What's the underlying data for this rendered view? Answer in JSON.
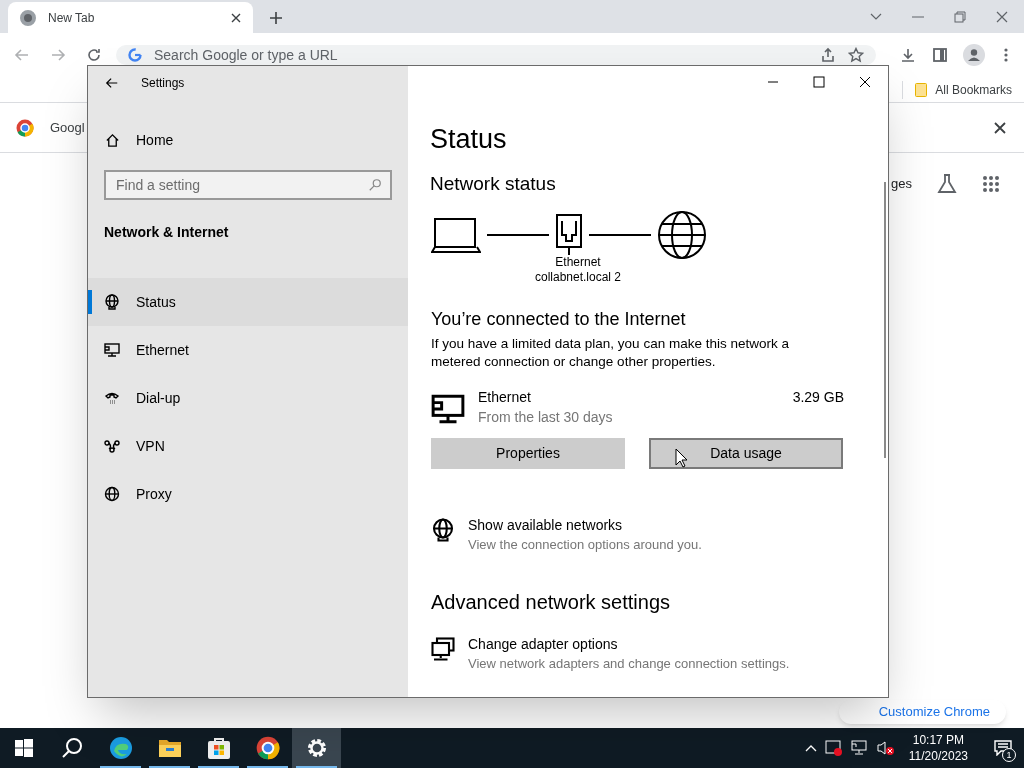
{
  "browser": {
    "tab": {
      "title": "New Tab"
    },
    "address_placeholder": "Search Google or type a URL",
    "bookmarks": {
      "label": "All Bookmarks"
    },
    "infobar": {
      "text": "Googl"
    },
    "ntp_link": "ges",
    "customize": "Customize Chrome"
  },
  "settings": {
    "title": "Settings",
    "home": "Home",
    "search_placeholder": "Find a setting",
    "section": "Network & Internet",
    "nav": [
      {
        "label": "Status",
        "kind": "status",
        "selected": true
      },
      {
        "label": "Ethernet",
        "kind": "ethernet",
        "selected": false
      },
      {
        "label": "Dial-up",
        "kind": "dialup",
        "selected": false
      },
      {
        "label": "VPN",
        "kind": "vpn",
        "selected": false
      },
      {
        "label": "Proxy",
        "kind": "proxy",
        "selected": false
      }
    ],
    "page_title": "Status",
    "network_heading": "Network status",
    "diagram_labels": [
      "Ethernet",
      "collabnet.local 2"
    ],
    "connected_heading": "You’re connected to the Internet",
    "description": "If you have a limited data plan, you can make this network a metered connection or change other properties.",
    "adapter": {
      "name": "Ethernet",
      "subtitle": "From the last 30 days",
      "usage": "3.29 GB"
    },
    "buttons": [
      {
        "label": "Properties",
        "hovered": false
      },
      {
        "label": "Data usage",
        "hovered": true
      }
    ],
    "links": [
      {
        "title": "Show available networks",
        "subtitle": "View the connection options around you.",
        "kind": "networks"
      }
    ],
    "advanced_heading": "Advanced network settings",
    "advanced_links": [
      {
        "title": "Change adapter options",
        "subtitle": "View network adapters and change connection settings.",
        "kind": "adapter"
      }
    ]
  },
  "taskbar": {
    "apps": [
      {
        "kind": "edge",
        "selected": false
      },
      {
        "kind": "explorer",
        "selected": false
      },
      {
        "kind": "store",
        "selected": false
      },
      {
        "kind": "chrome",
        "selected": false
      },
      {
        "kind": "settings",
        "selected": true
      }
    ],
    "time": "10:17 PM",
    "date": "11/20/2023",
    "notifications": "1"
  }
}
